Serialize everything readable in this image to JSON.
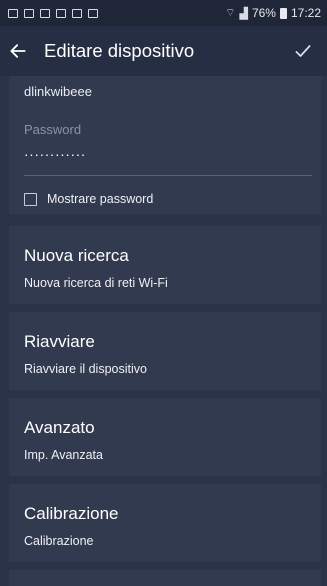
{
  "status_bar": {
    "battery": "76%",
    "time": "17:22"
  },
  "app_bar": {
    "title": "Editare dispositivo",
    "back_icon": "arrow-left-icon",
    "confirm_icon": "check-icon"
  },
  "form": {
    "network_name_value": "dlinkwibeee",
    "password_label": "Password",
    "password_value": "············",
    "show_password_label": "Mostrare password",
    "show_password_checked": false
  },
  "items": [
    {
      "title": "Nuova ricerca",
      "subtitle": "Nuova ricerca di reti Wi-Fi"
    },
    {
      "title": "Riavviare",
      "subtitle": "Riavviare il dispositivo"
    },
    {
      "title": "Avanzato",
      "subtitle": "Imp. Avanzata"
    },
    {
      "title": "Calibrazione",
      "subtitle": "Calibrazione"
    }
  ],
  "colors": {
    "background": "#2b3349",
    "card": "#323a4f",
    "app_bar": "#262e43",
    "status_bar": "#1f2638"
  }
}
